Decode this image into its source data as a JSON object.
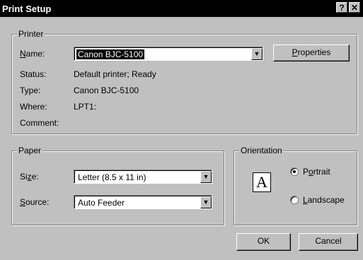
{
  "window": {
    "title": "Print Setup",
    "help_glyph": "?",
    "close_glyph": "✕"
  },
  "printer": {
    "group_title": "Printer",
    "name_label": "Name:",
    "name_label_access": "N",
    "name_label_rest": "ame:",
    "name_value": "Canon BJC-5100",
    "properties_label_access": "P",
    "properties_label_rest": "roperties",
    "status_label": "Status:",
    "status_value": "Default printer; Ready",
    "type_label": "Type:",
    "type_value": "Canon BJC-5100",
    "where_label": "Where:",
    "where_value": "LPT1:",
    "comment_label": "Comment:",
    "comment_value": ""
  },
  "paper": {
    "group_title": "Paper",
    "size_label_pre": "Si",
    "size_label_access": "z",
    "size_label_post": "e:",
    "size_value": "Letter (8.5 x 11 in)",
    "source_label_access": "S",
    "source_label_rest": "ource:",
    "source_value": "Auto Feeder"
  },
  "orientation": {
    "group_title": "Orientation",
    "icon_glyph": "A",
    "portrait_pre": "P",
    "portrait_access": "o",
    "portrait_post": "rtrait",
    "landscape_access": "L",
    "landscape_rest": "andscape",
    "selected": "portrait"
  },
  "buttons": {
    "ok": "OK",
    "cancel": "Cancel"
  },
  "icons": {
    "dropdown": "▼"
  }
}
